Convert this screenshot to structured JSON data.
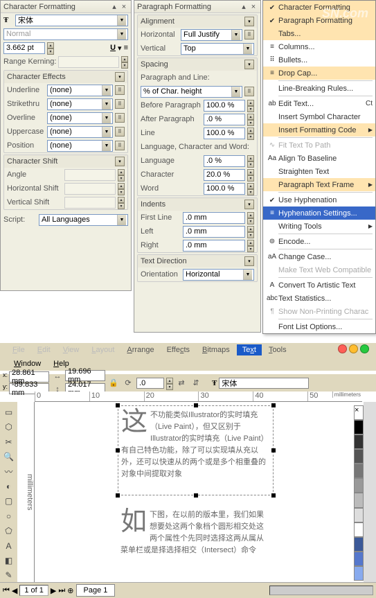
{
  "charPanel": {
    "title": "Character Formatting",
    "font": "宋体",
    "style": "Normal",
    "size": "3.662 pt",
    "kerning_label": "Range Kerning:",
    "effects": {
      "title": "Character Effects",
      "rows": [
        {
          "label": "Underline",
          "val": "(none)"
        },
        {
          "label": "Strikethru",
          "val": "(none)"
        },
        {
          "label": "Overline",
          "val": "(none)"
        },
        {
          "label": "Uppercase",
          "val": "(none)"
        },
        {
          "label": "Position",
          "val": "(none)"
        }
      ]
    },
    "shift": {
      "title": "Character Shift",
      "rows": [
        "Angle",
        "Horizontal Shift",
        "Vertical Shift"
      ]
    },
    "script_label": "Script:",
    "script_val": "All Languages"
  },
  "paraPanel": {
    "title": "Paragraph Formatting",
    "align": {
      "title": "Alignment",
      "horiz_lbl": "Horizontal",
      "horiz_val": "Full Justify",
      "vert_lbl": "Vertical",
      "vert_val": "Top"
    },
    "spacing": {
      "title": "Spacing",
      "pl_label": "Paragraph and Line:",
      "pl_val": "% of Char. height",
      "before_lbl": "Before Paragraph",
      "before_val": "100.0 %",
      "after_lbl": "After Paragraph",
      "after_val": ".0 %",
      "line_lbl": "Line",
      "line_val": "100.0 %",
      "lcw_label": "Language, Character and Word:",
      "lang_lbl": "Language",
      "lang_val": ".0 %",
      "char_lbl": "Character",
      "char_val": "20.0 %",
      "word_lbl": "Word",
      "word_val": "100.0 %"
    },
    "indents": {
      "title": "Indents",
      "first_lbl": "First Line",
      "first_val": ".0 mm",
      "left_lbl": "Left",
      "left_val": ".0 mm",
      "right_lbl": "Right",
      "right_val": ".0 mm"
    },
    "dir": {
      "title": "Text Direction",
      "orient_lbl": "Orientation",
      "orient_val": "Horizontal"
    }
  },
  "menu": {
    "items": [
      {
        "label": "Character Formatting",
        "icon": "chk",
        "hi": true
      },
      {
        "label": "Paragraph Formatting",
        "icon": "chk",
        "hi": true
      },
      {
        "label": "Tabs...",
        "icon": "",
        "hi": true
      },
      {
        "label": "Columns...",
        "icon": "≡",
        "hi": false
      },
      {
        "label": "Bullets...",
        "icon": "⠿",
        "hi": false
      },
      {
        "label": "Drop Cap...",
        "icon": "≡",
        "hi": true
      },
      {
        "sep": true
      },
      {
        "label": "Line-Breaking Rules...",
        "icon": "",
        "hi": false
      },
      {
        "sep": true
      },
      {
        "label": "Edit Text...",
        "icon": "ab",
        "shortcut": "Ct",
        "hi": false
      },
      {
        "label": "Insert Symbol Character",
        "icon": "",
        "hi": false
      },
      {
        "label": "Insert Formatting Code",
        "icon": "",
        "hi": true,
        "sub": true
      },
      {
        "sep": true
      },
      {
        "label": "Fit Text To Path",
        "icon": "∿",
        "dis": true
      },
      {
        "label": "Align To Baseline",
        "icon": "Aa",
        "hi": false
      },
      {
        "label": "Straighten Text",
        "icon": "",
        "hi": false
      },
      {
        "label": "Paragraph Text Frame",
        "icon": "",
        "hi": true,
        "sub": true
      },
      {
        "sep": true
      },
      {
        "label": "Use Hyphenation",
        "icon": "chk",
        "hi": false
      },
      {
        "label": "Hyphenation Settings...",
        "icon": "≡",
        "sel": true
      },
      {
        "label": "Writing Tools",
        "icon": "",
        "hi": false,
        "sub": true
      },
      {
        "sep": true
      },
      {
        "label": "Encode...",
        "icon": "⊚",
        "hi": false
      },
      {
        "sep": true
      },
      {
        "label": "Change Case...",
        "icon": "aA",
        "hi": false
      },
      {
        "label": "Make Text Web Compatible",
        "icon": "",
        "dis": true
      },
      {
        "sep": true
      },
      {
        "label": "Convert To Artistic Text",
        "icon": "A",
        "hi": false
      },
      {
        "label": "Text Statistics...",
        "icon": "abc",
        "hi": false
      },
      {
        "label": "Show Non-Printing Charac",
        "icon": "¶",
        "dis": true
      },
      {
        "sep": true
      },
      {
        "label": "Font List Options...",
        "icon": "",
        "hi": false
      }
    ]
  },
  "menubar": [
    "File",
    "Edit",
    "View",
    "Layout",
    "Arrange",
    "Effects",
    "Bitmaps",
    "Text",
    "Tools"
  ],
  "menubar2": [
    "Window",
    "Help"
  ],
  "toolbar": {
    "x": "28.861 mm",
    "y": "-89.833 mm",
    "w": "19.696 mm",
    "h": "24.017 mm",
    "rot": ".0",
    "font": "宋体"
  },
  "ruler": {
    "unit": "millimeters",
    "ticks": [
      "0",
      "10",
      "20",
      "30",
      "40",
      "50"
    ]
  },
  "canvas": {
    "char1": "这",
    "text1": "不功能类似Illustrator的实时填充（Live Paint），但又区别于Illustrator的实时填充（Live Paint）有自己特色功能，除了可以实现填从充以外，还可以快速从的两个或是多个相重叠的对象中间提取对象",
    "char2": "如",
    "text2": "下图，在以前的版本里，我们如果想要处这两个象档个圆形相交处这两个属性个先同时选择这两从属从菜单栏或是择选择相交（Intersect）命令"
  },
  "status": {
    "page": "Page 1",
    "pages": "1 of 1"
  },
  "font_icon": "Ŧ"
}
